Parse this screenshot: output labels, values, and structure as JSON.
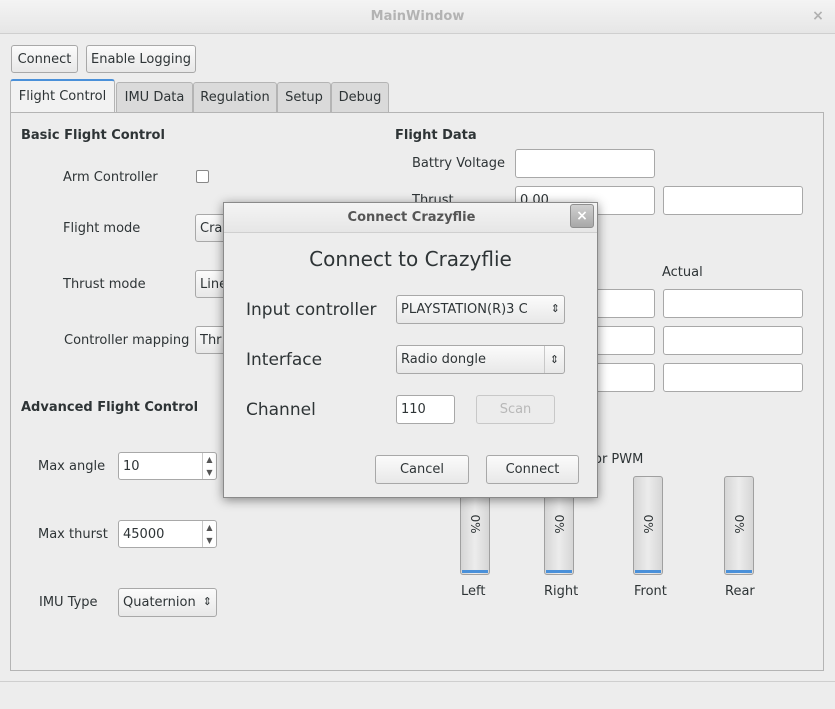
{
  "window": {
    "title": "MainWindow",
    "close_glyph": "×"
  },
  "toolbar": {
    "connect_label": "Connect",
    "logging_label": "Enable Logging"
  },
  "tabs": [
    {
      "label": "Flight Control"
    },
    {
      "label": "IMU Data"
    },
    {
      "label": "Regulation"
    },
    {
      "label": "Setup"
    },
    {
      "label": "Debug"
    }
  ],
  "basic": {
    "heading": "Basic Flight Control",
    "arm_label": "Arm Controller",
    "arm_checked": false,
    "flight_mode_label": "Flight mode",
    "flight_mode_value": "Cra",
    "thrust_mode_label": "Thrust mode",
    "thrust_mode_value": "Line",
    "mapping_label": "Controller mapping",
    "mapping_value": "Thr"
  },
  "advanced": {
    "heading": "Advanced Flight Control",
    "max_angle_label": "Max angle",
    "max_angle_value": "10",
    "max_thrust_label": "Max thurst",
    "max_thrust_value": "45000",
    "imu_type_label": "IMU Type",
    "imu_type_value": "Quaternion"
  },
  "flight_data": {
    "heading": "Flight Data",
    "battery_label": "Battry Voltage",
    "battery_value": "",
    "thrust_label": "Thrust",
    "thrust_value": "0.00",
    "thrust_actual": "",
    "actual_header": "Actual"
  },
  "motor": {
    "heading": "or PWM",
    "bars": [
      {
        "label": "Left",
        "value": "0%"
      },
      {
        "label": "Right",
        "value": "0%"
      },
      {
        "label": "Front",
        "value": "0%"
      },
      {
        "label": "Rear",
        "value": "0%"
      }
    ]
  },
  "dialog": {
    "title": "Connect Crazyflie",
    "close_glyph": "×",
    "heading": "Connect to Crazyflie",
    "input_label": "Input controller",
    "input_value": "PLAYSTATION(R)3 C",
    "interface_label": "Interface",
    "interface_value": "Radio dongle",
    "channel_label": "Channel",
    "channel_value": "110",
    "scan_label": "Scan",
    "cancel_label": "Cancel",
    "connect_label": "Connect"
  },
  "icons": {
    "spin_up": "▲",
    "spin_down": "▼",
    "combo_arrows": "⇕"
  },
  "colors": {
    "accent": "#4a90d9"
  }
}
